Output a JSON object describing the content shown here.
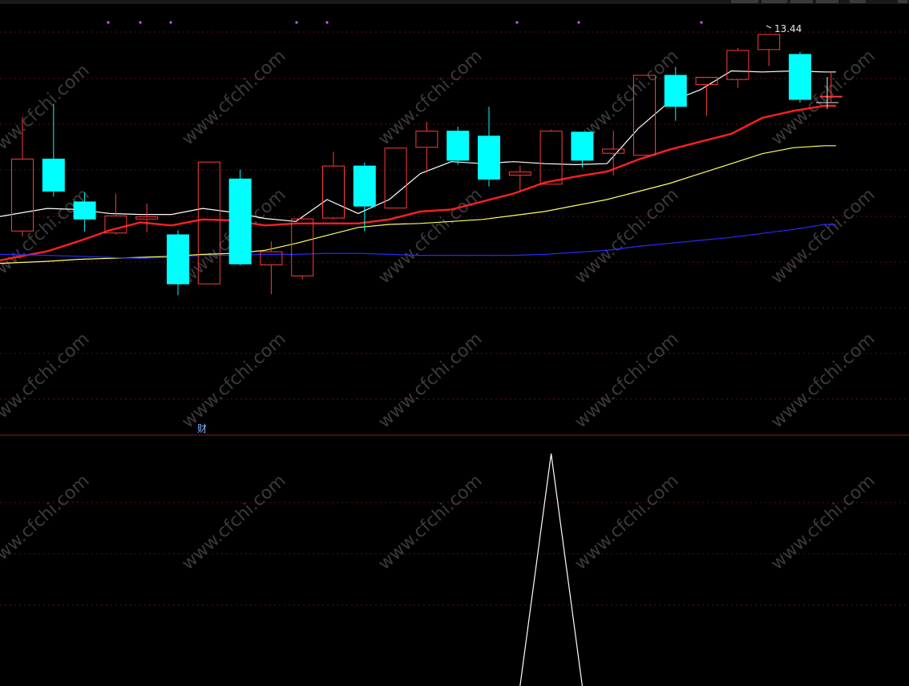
{
  "chart_data": [
    {
      "type": "candlestick",
      "title": "",
      "ylim": [
        10.4,
        13.6
      ],
      "price_high_label": "13.44",
      "grid": true,
      "colors": {
        "up": "#ff3b3b",
        "down": "#00ffff",
        "ma5": "#ffffff",
        "ma10": "#ff2020",
        "ma20": "#ffff66",
        "ma60": "#2a2aff",
        "grid": "#5a1414"
      },
      "candles": [
        {
          "o": 11.6,
          "c": 12.33,
          "h": 12.75,
          "l": 11.55
        },
        {
          "o": 12.33,
          "c": 12.0,
          "h": 12.88,
          "l": 11.95
        },
        {
          "o": 11.9,
          "c": 11.72,
          "h": 11.99,
          "l": 11.6
        },
        {
          "o": 11.58,
          "c": 11.76,
          "h": 11.98,
          "l": 11.57
        },
        {
          "o": 11.72,
          "c": 11.75,
          "h": 11.88,
          "l": 11.59
        },
        {
          "o": 11.57,
          "c": 11.07,
          "h": 11.61,
          "l": 10.96
        },
        {
          "o": 11.07,
          "c": 12.3,
          "h": 12.3,
          "l": 11.07
        },
        {
          "o": 12.13,
          "c": 11.27,
          "h": 12.22,
          "l": 11.26
        },
        {
          "o": 11.26,
          "c": 11.4,
          "h": 11.5,
          "l": 10.97
        },
        {
          "o": 11.15,
          "c": 11.73,
          "h": 11.74,
          "l": 11.12
        },
        {
          "o": 11.73,
          "c": 12.26,
          "h": 12.4,
          "l": 11.72
        },
        {
          "o": 12.26,
          "c": 11.85,
          "h": 12.29,
          "l": 11.6
        },
        {
          "o": 11.83,
          "c": 12.44,
          "h": 12.44,
          "l": 11.83
        },
        {
          "o": 12.44,
          "c": 12.61,
          "h": 12.7,
          "l": 12.19
        },
        {
          "o": 12.61,
          "c": 12.31,
          "h": 12.65,
          "l": 12.27
        },
        {
          "o": 12.56,
          "c": 12.12,
          "h": 12.85,
          "l": 12.05
        },
        {
          "o": 12.16,
          "c": 12.2,
          "h": 12.26,
          "l": 12.0
        },
        {
          "o": 12.07,
          "c": 12.61,
          "h": 12.62,
          "l": 12.07
        },
        {
          "o": 12.6,
          "c": 12.31,
          "h": 12.6,
          "l": 12.24
        },
        {
          "o": 12.38,
          "c": 12.43,
          "h": 12.61,
          "l": 12.16
        },
        {
          "o": 12.36,
          "c": 13.17,
          "h": 13.17,
          "l": 12.36
        },
        {
          "o": 13.17,
          "c": 12.85,
          "h": 13.25,
          "l": 12.71
        },
        {
          "o": 13.07,
          "c": 13.15,
          "h": 13.15,
          "l": 12.76
        },
        {
          "o": 13.12,
          "c": 13.42,
          "h": 13.44,
          "l": 13.04
        },
        {
          "o": 13.42,
          "c": 13.58,
          "h": 13.58,
          "l": 13.26
        },
        {
          "o": 13.38,
          "c": 12.92,
          "h": 13.4,
          "l": 12.89
        },
        {
          "o": 12.96,
          "c": 12.96,
          "h": 13.2,
          "l": 12.9
        }
      ],
      "ma_series": [
        {
          "key": "ma5",
          "values": [
            11.75,
            11.83,
            11.82,
            11.78,
            11.77,
            11.77,
            11.83,
            11.79,
            11.73,
            11.7,
            11.92,
            11.78,
            11.92,
            12.18,
            12.3,
            12.28,
            12.3,
            12.28,
            12.27,
            12.28,
            12.63,
            12.9,
            13.02,
            13.21,
            13.2,
            13.21,
            13.2
          ]
        },
        {
          "key": "ma10",
          "values": [
            11.31,
            11.4,
            11.5,
            11.61,
            11.69,
            11.66,
            11.72,
            11.71,
            11.66,
            11.68,
            11.68,
            11.68,
            11.72,
            11.8,
            11.82,
            11.9,
            11.98,
            12.09,
            12.15,
            12.2,
            12.32,
            12.42,
            12.5,
            12.58,
            12.74,
            12.81,
            12.86
          ]
        },
        {
          "key": "ma20",
          "values": [
            11.28,
            11.3,
            11.32,
            11.33,
            11.34,
            11.35,
            11.37,
            11.38,
            11.41,
            11.48,
            11.56,
            11.64,
            11.67,
            11.68,
            11.7,
            11.72,
            11.76,
            11.8,
            11.86,
            11.92,
            12.0,
            12.08,
            12.18,
            12.28,
            12.38,
            12.44,
            12.46
          ]
        },
        {
          "key": "ma60",
          "values": [
            11.37,
            11.36,
            11.35,
            11.34,
            11.33,
            11.34,
            11.36,
            11.36,
            11.37,
            11.37,
            11.38,
            11.38,
            11.37,
            11.36,
            11.36,
            11.36,
            11.36,
            11.37,
            11.39,
            11.41,
            11.45,
            11.48,
            11.51,
            11.54,
            11.58,
            11.62,
            11.67
          ]
        }
      ]
    },
    {
      "type": "line",
      "title": "",
      "ylim": [
        0,
        1
      ],
      "color": "#ffffff",
      "series": [
        {
          "values": [
            0,
            0,
            0,
            0,
            0,
            0,
            0,
            0,
            0,
            0,
            0,
            0,
            0,
            0,
            0,
            0,
            0,
            1,
            0,
            0,
            0,
            0,
            0,
            0,
            0,
            0,
            0
          ]
        }
      ]
    }
  ],
  "markers": {
    "cai_label": "财"
  },
  "watermark": {
    "text": "www.cfchi.com"
  }
}
